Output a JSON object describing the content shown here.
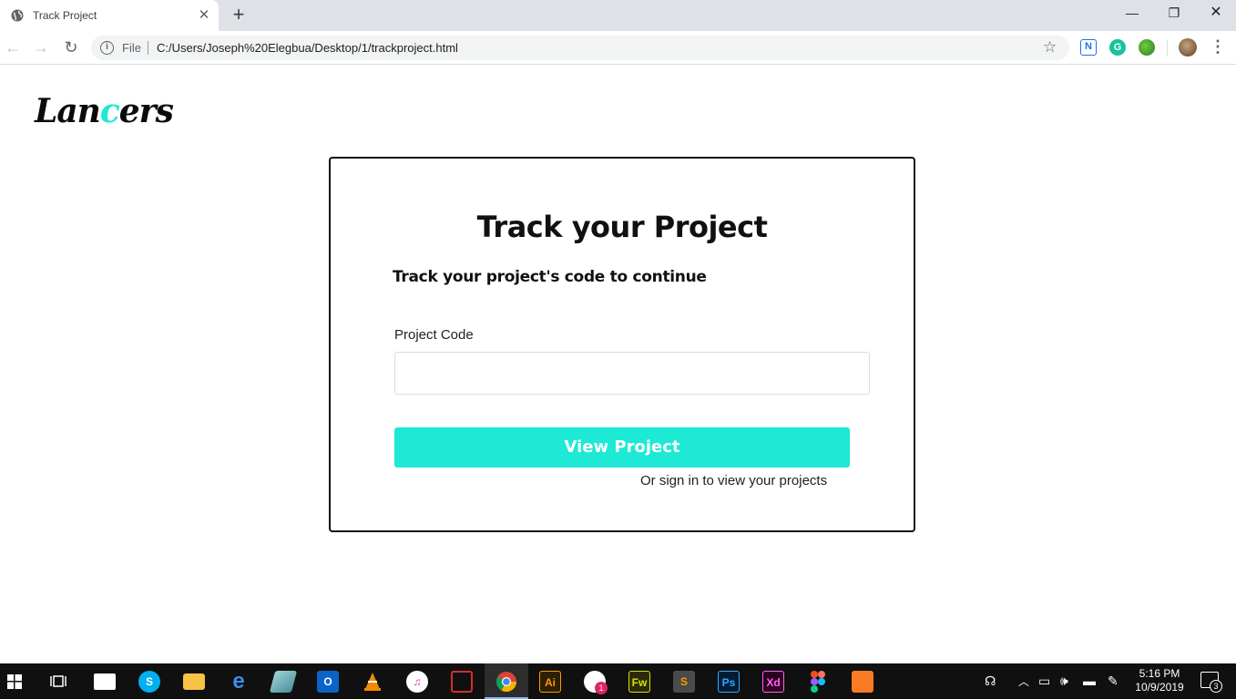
{
  "browser": {
    "tab_title": "Track Project",
    "file_label": "File",
    "url": "C:/Users/Joseph%20Elegbua/Desktop/1/trackproject.html",
    "ext_n_label": "N",
    "ext_g_label": "G"
  },
  "page": {
    "logo_part1": "Lan",
    "logo_accent": "c",
    "logo_part2": "ers",
    "card": {
      "title": "Track your Project",
      "subtitle": "Track your project's code to continue",
      "field_label": "Project Code",
      "field_value": "",
      "field_placeholder": "",
      "button_label": "View Project",
      "signin_text": "Or sign in to view your projects"
    },
    "colors": {
      "accent": "#1de9d5",
      "text": "#111111"
    }
  },
  "taskbar": {
    "time": "5:16 PM",
    "date": "10/9/2019",
    "notification_count": "3",
    "chat_badge": "1",
    "apps": [
      {
        "name": "task-view",
        "label": ""
      },
      {
        "name": "mail",
        "label": ""
      },
      {
        "name": "skype",
        "label": "S"
      },
      {
        "name": "file-explorer",
        "label": ""
      },
      {
        "name": "edge",
        "label": "e"
      },
      {
        "name": "app",
        "label": ""
      },
      {
        "name": "outlook",
        "label": "O"
      },
      {
        "name": "vlc",
        "label": ""
      },
      {
        "name": "itunes",
        "label": "♫"
      },
      {
        "name": "acrobat",
        "label": ""
      },
      {
        "name": "chrome",
        "label": ""
      },
      {
        "name": "illustrator",
        "label": "Ai"
      },
      {
        "name": "chat",
        "label": ""
      },
      {
        "name": "fireworks",
        "label": "Fw"
      },
      {
        "name": "sublime",
        "label": "S"
      },
      {
        "name": "photoshop",
        "label": "Ps"
      },
      {
        "name": "xd",
        "label": "Xd"
      },
      {
        "name": "figma",
        "label": ""
      },
      {
        "name": "xampp",
        "label": ""
      }
    ]
  }
}
